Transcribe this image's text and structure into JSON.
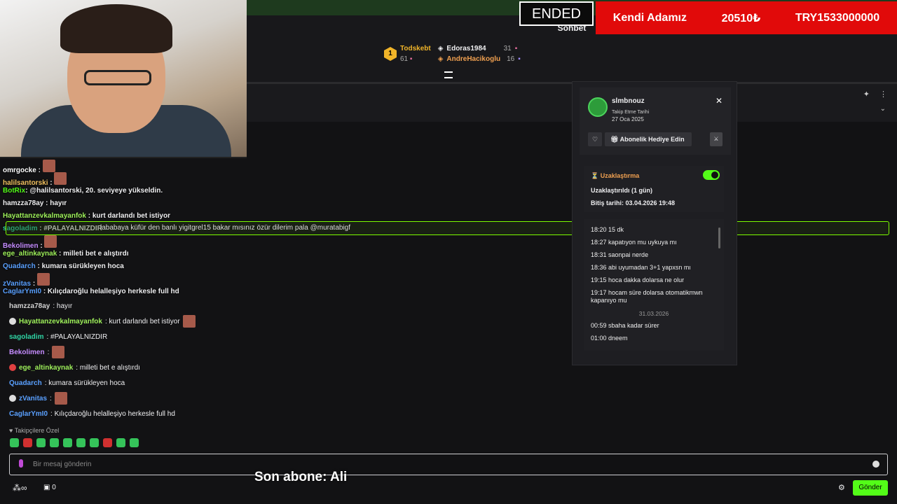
{
  "overlay": {
    "ended": "ENDED",
    "ticker": [
      "Kendi Adamız",
      "20510₺",
      "TRY1533000000"
    ],
    "subscriber": "Son abone: Ali"
  },
  "header": {
    "title": "Sohbet",
    "leaders": [
      {
        "rank": "1",
        "name": "Todskebt",
        "count": "61"
      },
      {
        "name": "Edoras1984",
        "count": "31"
      },
      {
        "name": "AndreHacikoglu",
        "count": "16"
      }
    ]
  },
  "overlay_chat": [
    {
      "user": "omrgocke",
      "text": ":"
    },
    {
      "user": "halilsantorski",
      "text": ":"
    },
    {
      "user": "BotRix",
      "text": ": @halilsantorski, 20. seviyeye yükseldin."
    },
    {
      "user": "hamzza78ay",
      "text": ": hayır"
    },
    {
      "user": "Hayattanzevkalmayanfok",
      "text": ": kurt darlandı bet istiyor"
    },
    {
      "user": "sagoladim",
      "text": ": #PALAYALNIZDIR"
    },
    {
      "user": "Bekolimen",
      "text": ":"
    },
    {
      "user": "ege_altinkaynak",
      "text": ": milleti bet e alıştırdı"
    },
    {
      "user": "Quadarch",
      "text": ": kumara sürükleyen hoca"
    },
    {
      "user": "zVanitas",
      "text": ":"
    },
    {
      "user": "CaglarYmI0",
      "text": ": Kılıçdaroğlu helalleşiyo herkesle full hd"
    }
  ],
  "highlight_text": "lababaya küfür den banlı yigitgrel15 bakar mısınız özür dilerim pala @muratabigf",
  "chat": [
    {
      "user": "hamzza78ay",
      "text": ": hayır",
      "color": "#d1d1d1"
    },
    {
      "user": "Hayattanzevkalmayanfok",
      "text": ": kurt darlandı bet istiyor",
      "color": "#9ef05a"
    },
    {
      "user": "sagoladim",
      "text": ": #PALAYALNIZDIR",
      "color": "#2fd4a4"
    },
    {
      "user": "Bekolimen",
      "text": ":",
      "color": "#c58cff"
    },
    {
      "user": "ege_altinkaynak",
      "text": ": milleti bet e alıştırdı",
      "color": "#9ef05a"
    },
    {
      "user": "Quadarch",
      "text": ": kumara sürükleyen hoca",
      "color": "#5aa0ff"
    },
    {
      "user": "zVanitas",
      "text": ":",
      "color": "#5aa0ff"
    },
    {
      "user": "CaglarYmI0",
      "text": ": Kılıçdaroğlu helalleşiyo herkesle full hd",
      "color": "#5aa0ff"
    }
  ],
  "follower_only": "Takipçilere Özel",
  "input": {
    "placeholder": "Bir mesaj gönderin"
  },
  "footer": {
    "count": "0",
    "send": "Gönder"
  },
  "user_card": {
    "username": "slmbnouz",
    "follow_label": "Takip Etme Tarihi",
    "follow_date": "27 Oca 2025",
    "gift_label": "Abonelik Hediye Edin",
    "timeout": {
      "title": "Uzaklaştırma",
      "status": "Uzaklaştırıldı (1 gün)",
      "expiry": "Bitiş tarihi: 03.04.2026 19:48"
    },
    "history": [
      "18:20 15 dk",
      "18:27 kapatıyon mu uykuya mı",
      "18:31 saonpai nerde",
      "18:36 abi uyumadan 3+1 yapxsn mı",
      "19:15 hoca dakka dolarsa ne olur",
      "19:17 hocam süre dolarsa otomatikmwn kapanıyo mu"
    ],
    "date_separator": "31.03.2026",
    "history2": [
      "00:59 sbaha kadar sürer",
      "01:00 dneem"
    ]
  }
}
